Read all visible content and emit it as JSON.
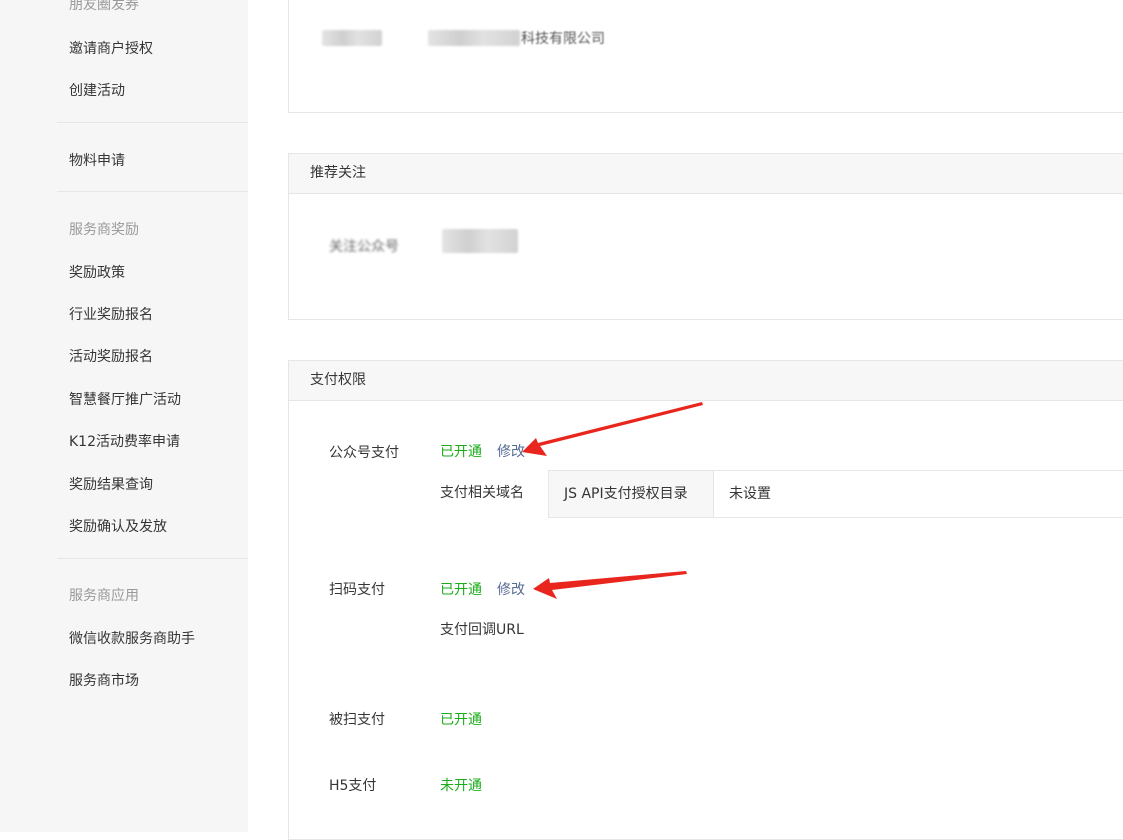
{
  "sidebar": {
    "top_cut_section": "朋友圈发券",
    "items_group1": [
      "邀请商户授权",
      "创建活动"
    ],
    "items_group2": [
      "物料申请"
    ],
    "section_rewards": "服务商奖励",
    "items_rewards": [
      "奖励政策",
      "行业奖励报名",
      "活动奖励报名",
      "智慧餐厅推广活动",
      "K12活动费率申请",
      "奖励结果查询",
      "奖励确认及发放"
    ],
    "section_apps": "服务商应用",
    "items_apps": [
      "微信收款服务商助手",
      "服务商市场"
    ]
  },
  "company_panel": {
    "company_suffix": "科技有限公司"
  },
  "recommend_panel": {
    "title": "推荐关注",
    "follow_label": "关注公众号"
  },
  "payment_panel": {
    "title": "支付权限",
    "jsapi": {
      "label": "公众号支付",
      "status": "已开通",
      "action": "修改",
      "domain_label": "支付相关域名",
      "table_label": "JS API支付授权目录",
      "table_value": "未设置"
    },
    "native": {
      "label": "扫码支付",
      "status": "已开通",
      "action": "修改",
      "callback_label": "支付回调URL"
    },
    "micropay": {
      "label": "被扫支付",
      "status": "已开通"
    },
    "h5": {
      "label": "H5支付",
      "status": "未开通"
    }
  },
  "colors": {
    "status_green": "#1aad19",
    "link_blue": "#576b95",
    "annotation_red": "#e8261e"
  }
}
